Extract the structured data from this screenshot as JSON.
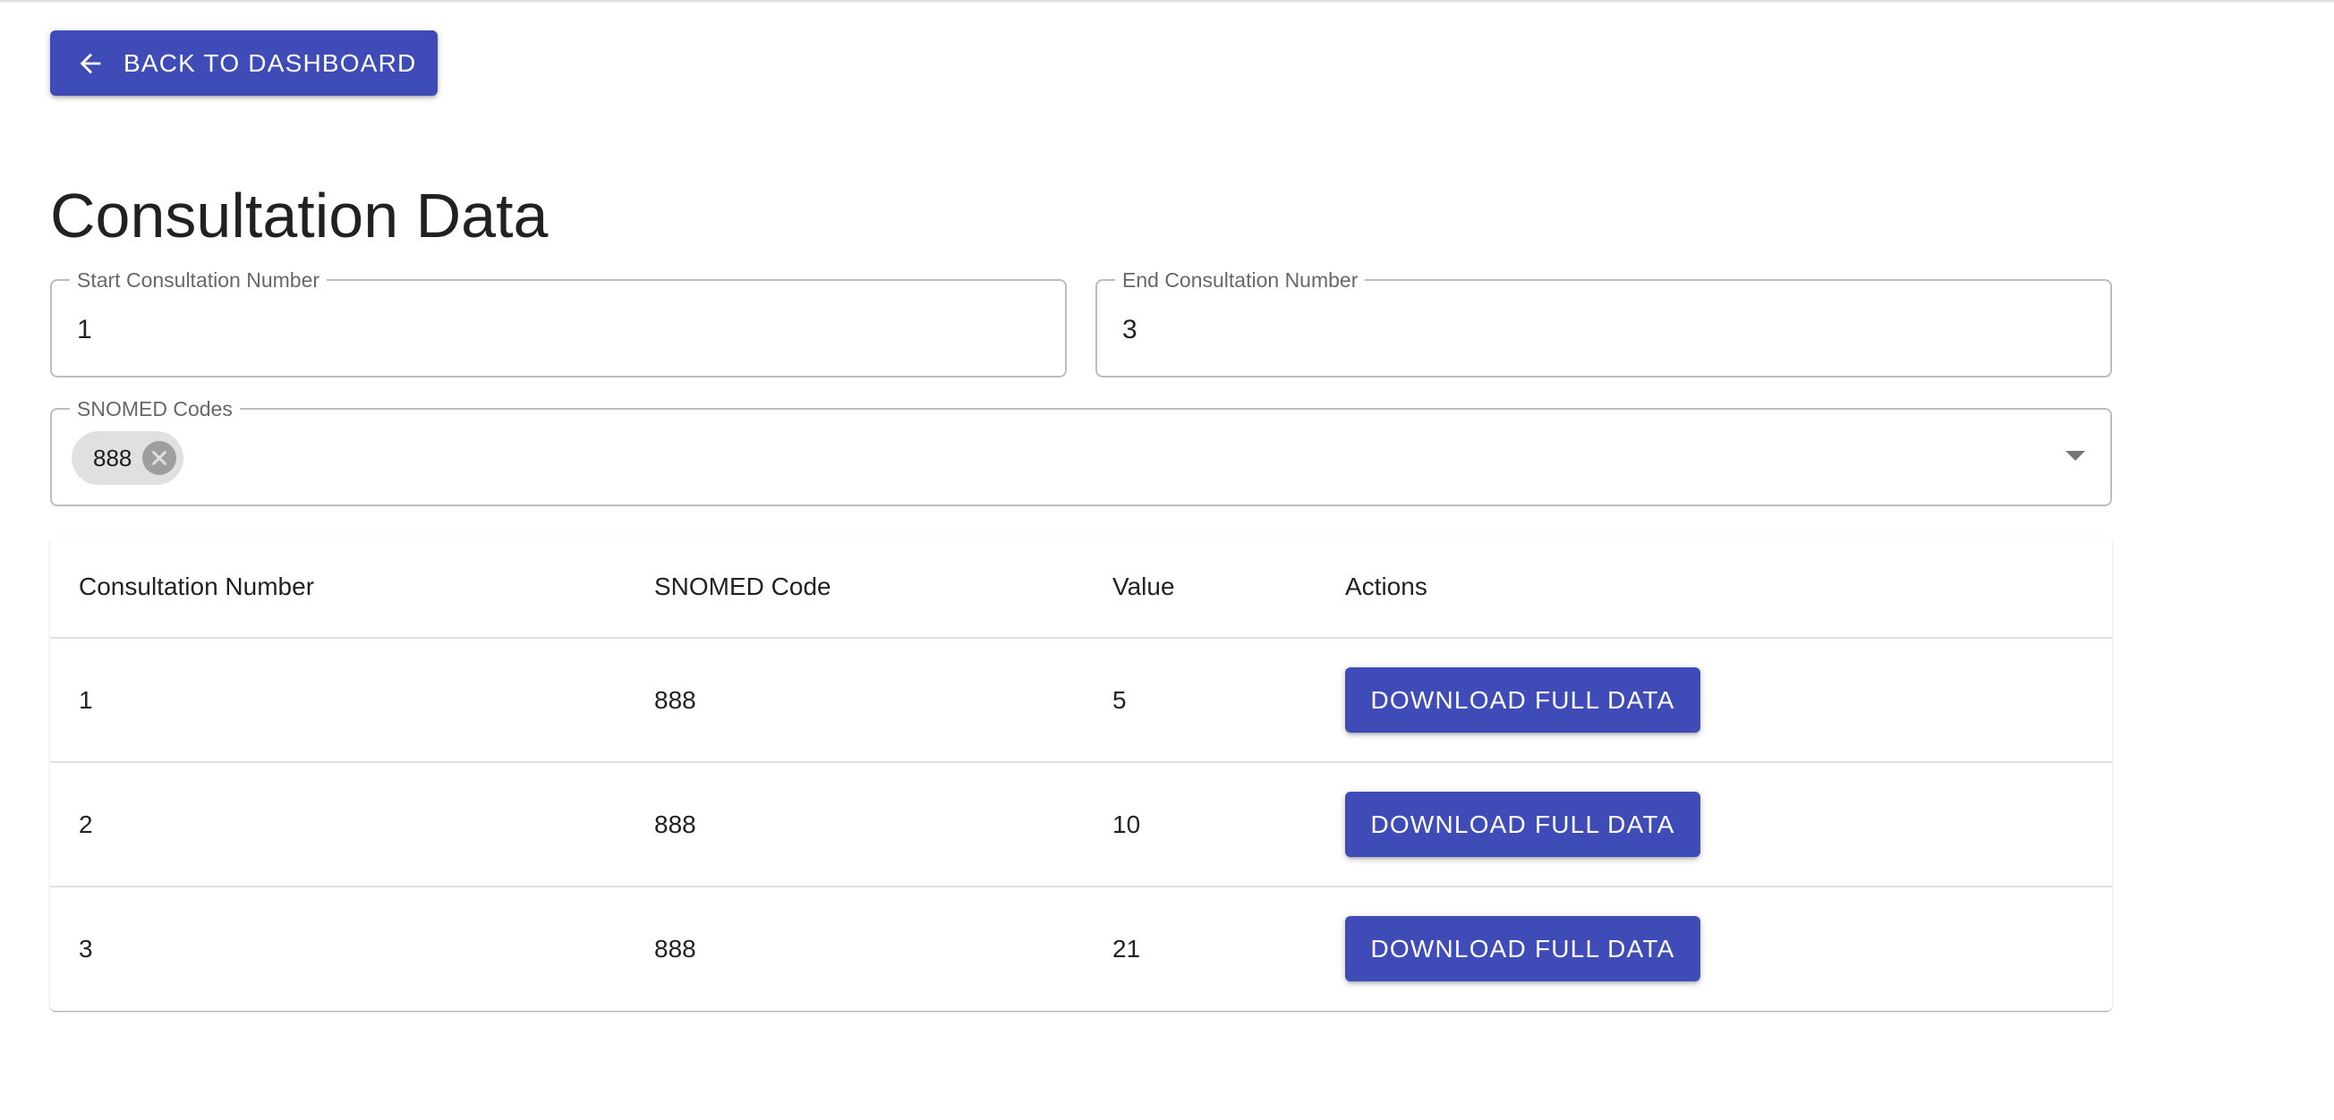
{
  "colors": {
    "primary": "#3f4bb7",
    "chip_bg": "#e0e0e0",
    "border": "#bdbdbd"
  },
  "header": {
    "back_label": "BACK TO DASHBOARD",
    "back_icon": "arrow-left-icon"
  },
  "page_title": "Consultation Data",
  "filters": {
    "start": {
      "label": "Start Consultation Number",
      "value": "1"
    },
    "end": {
      "label": "End Consultation Number",
      "value": "3"
    },
    "snomed": {
      "label": "SNOMED Codes",
      "chips": [
        "888"
      ],
      "dropdown_icon": "caret-down-icon",
      "chip_delete_icon": "cancel-circle-icon"
    }
  },
  "table": {
    "headers": [
      "Consultation Number",
      "SNOMED Code",
      "Value",
      "Actions"
    ],
    "rows": [
      {
        "consultation_number": "1",
        "snomed_code": "888",
        "value": "5",
        "action_label": "DOWNLOAD FULL DATA"
      },
      {
        "consultation_number": "2",
        "snomed_code": "888",
        "value": "10",
        "action_label": "DOWNLOAD FULL DATA"
      },
      {
        "consultation_number": "3",
        "snomed_code": "888",
        "value": "21",
        "action_label": "DOWNLOAD FULL DATA"
      }
    ]
  }
}
